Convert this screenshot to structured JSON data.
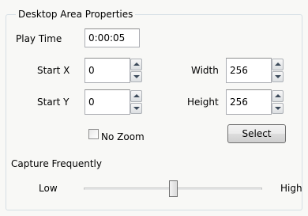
{
  "group": {
    "title": "Desktop Area Properties"
  },
  "play_time": {
    "label": "Play Time",
    "value": "0:00:05"
  },
  "start_x": {
    "label": "Start X",
    "value": "0"
  },
  "start_y": {
    "label": "Start Y",
    "value": "0"
  },
  "width": {
    "label": "Width",
    "value": "256"
  },
  "height": {
    "label": "Height",
    "value": "256"
  },
  "no_zoom": {
    "label": "No Zoom",
    "checked": false
  },
  "select_button": {
    "label": "Select"
  },
  "capture": {
    "label": "Capture Frequently",
    "low_label": "Low",
    "high_label": "High",
    "level": 0.5
  }
}
